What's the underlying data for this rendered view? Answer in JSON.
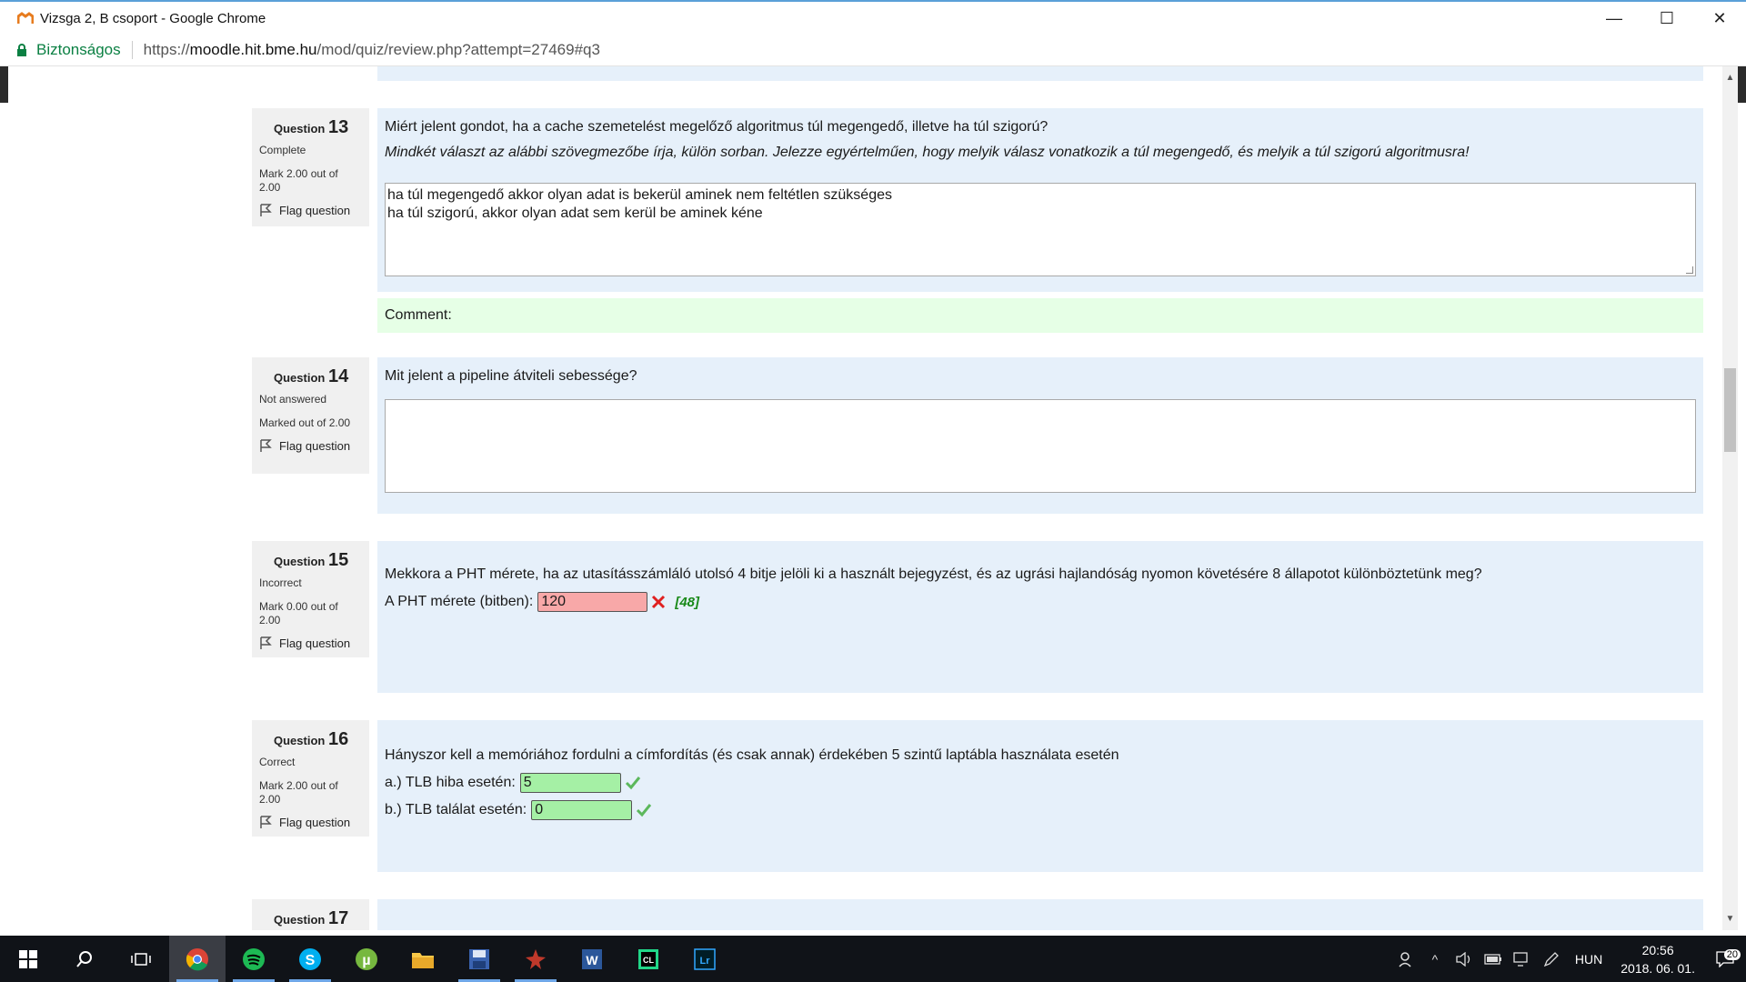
{
  "window": {
    "title": "Vizsga 2, B csoport - Google Chrome",
    "minimize": "—",
    "maximize": "☐",
    "close": "✕"
  },
  "address": {
    "secure_label": "Biztonságos",
    "url_scheme": "https://",
    "url_host": "moodle.hit.bme.hu",
    "url_path": "/mod/quiz/review.php?attempt=27469#q3"
  },
  "questions": {
    "q13": {
      "label": "Question",
      "number": "13",
      "state": "Complete",
      "grade": "Mark 2.00 out of 2.00",
      "flag": "Flag question",
      "text": "Miért jelent gondot, ha a cache szemetelést megelőző algoritmus túl megengedő, illetve ha túl szigorú?",
      "hint": "Mindkét választ az alábbi szövegmezőbe írja, külön sorban. Jelezze egyértelműen, hogy melyik válasz vonatkozik a túl megengedő, és melyik a túl szigorú algoritmusra!",
      "answer_line1": "ha túl megengedő akkor olyan adat is bekerül aminek nem feltétlen szükséges",
      "answer_line2": "ha túl szigorú, akkor olyan adat sem kerül be aminek kéne",
      "comment": "Comment:"
    },
    "q14": {
      "label": "Question",
      "number": "14",
      "state": "Not answered",
      "grade": "Marked out of 2.00",
      "flag": "Flag question",
      "text": "Mit jelent a pipeline átviteli sebessége?",
      "answer": ""
    },
    "q15": {
      "label": "Question",
      "number": "15",
      "state": "Incorrect",
      "grade": "Mark 0.00 out of 2.00",
      "flag": "Flag question",
      "text": "Mekkora a PHT mérete, ha az utasításszámláló utolsó 4 bitje jelöli ki a használt bejegyzést, és az ugrási hajlandóság nyomon követésére 8 állapotot különböztetünk meg?",
      "field_label": "A PHT mérete (bitben):",
      "field_value": "120",
      "right_answer": "[48]"
    },
    "q16": {
      "label": "Question",
      "number": "16",
      "state": "Correct",
      "grade": "Mark 2.00 out of 2.00",
      "flag": "Flag question",
      "text": "Hányszor kell a memóriához fordulni a címfordítás (és csak annak) érdekében 5 szintű laptábla használata esetén",
      "a_label": "a.) TLB hiba esetén:",
      "a_value": "5",
      "b_label": "b.) TLB találat esetén:",
      "b_value": "0"
    },
    "q17": {
      "label": "Question",
      "number": "17"
    }
  },
  "tray": {
    "lang": "HUN",
    "time": "20:56",
    "date": "2018. 06. 01.",
    "notifications": "20"
  },
  "colors": {
    "question_bg": "#e6f0fa",
    "info_bg": "#f0f0f0",
    "comment_bg": "#e6ffe6",
    "incorrect": "#f8a8a8",
    "correct": "#a5f0a5"
  }
}
